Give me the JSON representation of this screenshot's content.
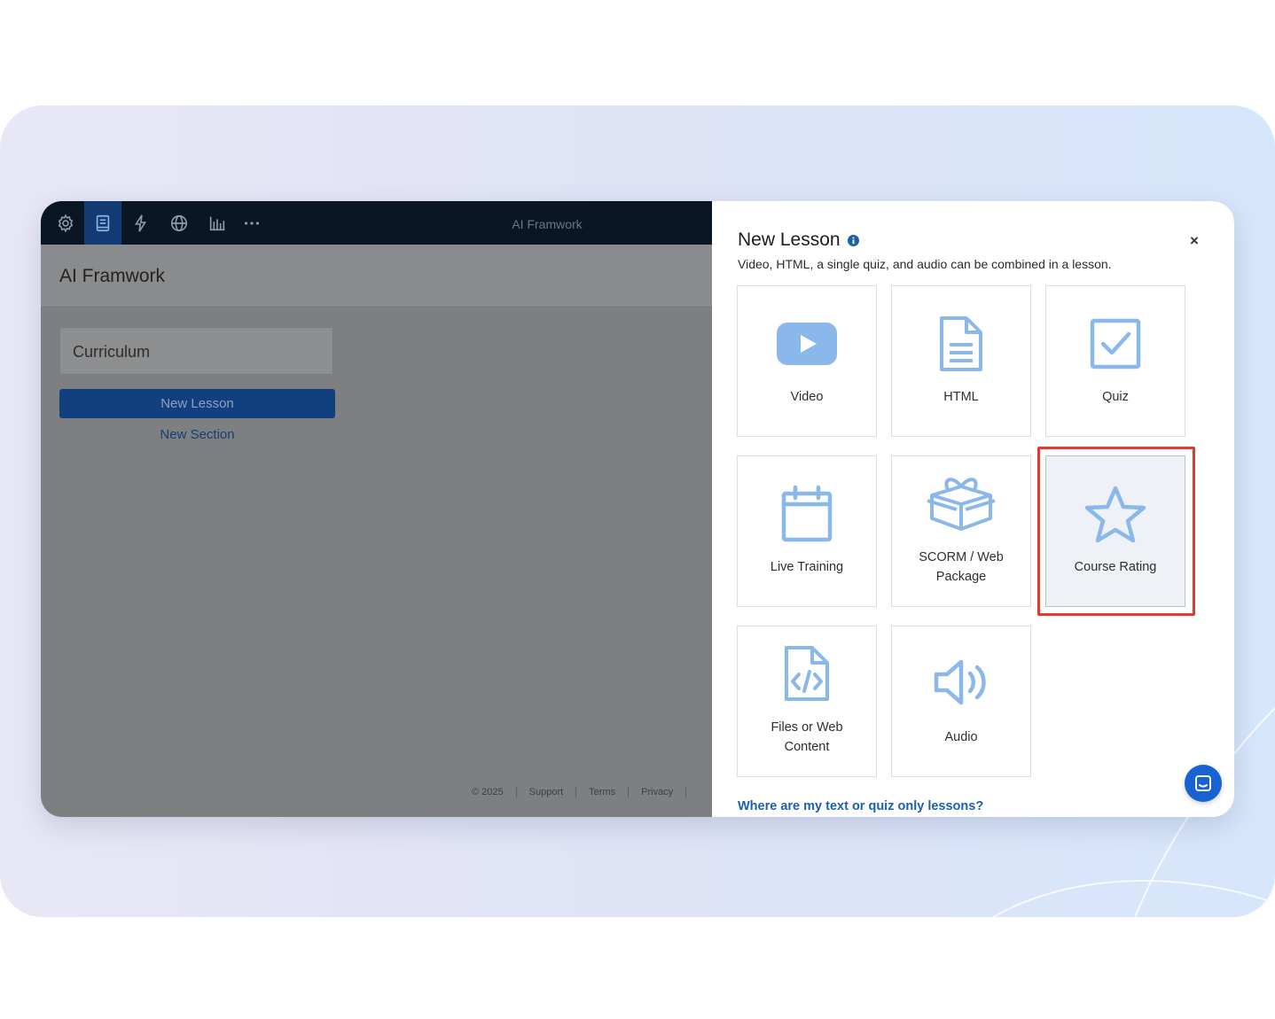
{
  "app": {
    "window_title": "AI Framwork",
    "page_title": "AI Framwork"
  },
  "toolbar": {
    "icons": [
      "gear-icon",
      "book-icon",
      "bolt-icon",
      "globe-icon",
      "chart-icon",
      "more-icon"
    ],
    "active_icon": "book-icon"
  },
  "sidebar": {
    "curriculum_label": "Curriculum",
    "new_lesson_label": "New Lesson",
    "new_section_label": "New Section"
  },
  "footer": {
    "items": [
      "© 2025",
      "Support",
      "Terms",
      "Privacy"
    ]
  },
  "dialog": {
    "title": "New Lesson",
    "subtitle": "Video, HTML, a single quiz, and audio can be combined in a lesson.",
    "close_symbol": "×",
    "tiles": [
      {
        "label": "Video",
        "icon": "video-icon"
      },
      {
        "label": "HTML",
        "icon": "document-icon"
      },
      {
        "label": "Quiz",
        "icon": "checkbox-icon"
      },
      {
        "label": "Live Training",
        "icon": "calendar-icon"
      },
      {
        "label_line1": "SCORM / Web",
        "label_line2": "Package",
        "icon": "gift-box-icon"
      },
      {
        "label": "Course Rating",
        "icon": "star-icon",
        "selected": true
      },
      {
        "label_line1": "Files or Web",
        "label_line2": "Content",
        "icon": "code-file-icon"
      },
      {
        "label": "Audio",
        "icon": "speaker-icon"
      }
    ],
    "help_link": "Where are my text or quiz only lessons?"
  },
  "colors": {
    "icon_blue": "#8bb8ea",
    "highlight_red": "#e03a2f",
    "primary_button": "#123f7d",
    "topbar": "#0b1624",
    "chat_button": "#1763d3"
  }
}
